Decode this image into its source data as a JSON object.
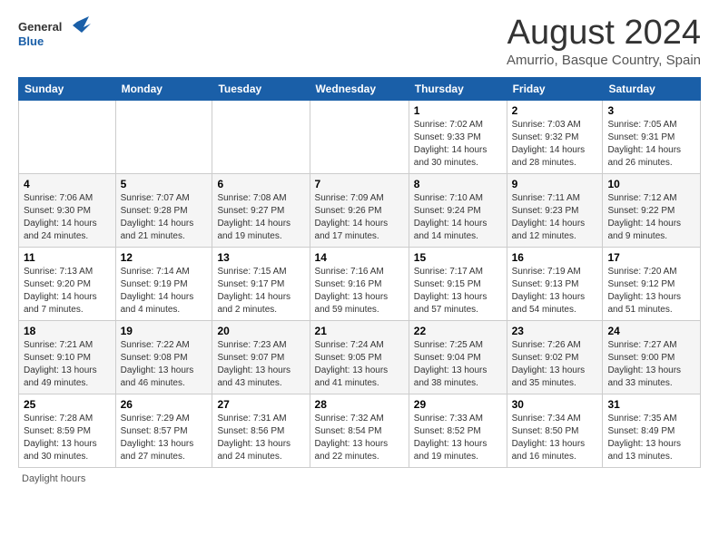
{
  "logo": {
    "general": "General",
    "blue": "Blue"
  },
  "title": "August 2024",
  "subtitle": "Amurrio, Basque Country, Spain",
  "weekdays": [
    "Sunday",
    "Monday",
    "Tuesday",
    "Wednesday",
    "Thursday",
    "Friday",
    "Saturday"
  ],
  "weeks": [
    [
      {
        "day": "",
        "info": ""
      },
      {
        "day": "",
        "info": ""
      },
      {
        "day": "",
        "info": ""
      },
      {
        "day": "",
        "info": ""
      },
      {
        "day": "1",
        "info": "Sunrise: 7:02 AM\nSunset: 9:33 PM\nDaylight: 14 hours\nand 30 minutes."
      },
      {
        "day": "2",
        "info": "Sunrise: 7:03 AM\nSunset: 9:32 PM\nDaylight: 14 hours\nand 28 minutes."
      },
      {
        "day": "3",
        "info": "Sunrise: 7:05 AM\nSunset: 9:31 PM\nDaylight: 14 hours\nand 26 minutes."
      }
    ],
    [
      {
        "day": "4",
        "info": "Sunrise: 7:06 AM\nSunset: 9:30 PM\nDaylight: 14 hours\nand 24 minutes."
      },
      {
        "day": "5",
        "info": "Sunrise: 7:07 AM\nSunset: 9:28 PM\nDaylight: 14 hours\nand 21 minutes."
      },
      {
        "day": "6",
        "info": "Sunrise: 7:08 AM\nSunset: 9:27 PM\nDaylight: 14 hours\nand 19 minutes."
      },
      {
        "day": "7",
        "info": "Sunrise: 7:09 AM\nSunset: 9:26 PM\nDaylight: 14 hours\nand 17 minutes."
      },
      {
        "day": "8",
        "info": "Sunrise: 7:10 AM\nSunset: 9:24 PM\nDaylight: 14 hours\nand 14 minutes."
      },
      {
        "day": "9",
        "info": "Sunrise: 7:11 AM\nSunset: 9:23 PM\nDaylight: 14 hours\nand 12 minutes."
      },
      {
        "day": "10",
        "info": "Sunrise: 7:12 AM\nSunset: 9:22 PM\nDaylight: 14 hours\nand 9 minutes."
      }
    ],
    [
      {
        "day": "11",
        "info": "Sunrise: 7:13 AM\nSunset: 9:20 PM\nDaylight: 14 hours\nand 7 minutes."
      },
      {
        "day": "12",
        "info": "Sunrise: 7:14 AM\nSunset: 9:19 PM\nDaylight: 14 hours\nand 4 minutes."
      },
      {
        "day": "13",
        "info": "Sunrise: 7:15 AM\nSunset: 9:17 PM\nDaylight: 14 hours\nand 2 minutes."
      },
      {
        "day": "14",
        "info": "Sunrise: 7:16 AM\nSunset: 9:16 PM\nDaylight: 13 hours\nand 59 minutes."
      },
      {
        "day": "15",
        "info": "Sunrise: 7:17 AM\nSunset: 9:15 PM\nDaylight: 13 hours\nand 57 minutes."
      },
      {
        "day": "16",
        "info": "Sunrise: 7:19 AM\nSunset: 9:13 PM\nDaylight: 13 hours\nand 54 minutes."
      },
      {
        "day": "17",
        "info": "Sunrise: 7:20 AM\nSunset: 9:12 PM\nDaylight: 13 hours\nand 51 minutes."
      }
    ],
    [
      {
        "day": "18",
        "info": "Sunrise: 7:21 AM\nSunset: 9:10 PM\nDaylight: 13 hours\nand 49 minutes."
      },
      {
        "day": "19",
        "info": "Sunrise: 7:22 AM\nSunset: 9:08 PM\nDaylight: 13 hours\nand 46 minutes."
      },
      {
        "day": "20",
        "info": "Sunrise: 7:23 AM\nSunset: 9:07 PM\nDaylight: 13 hours\nand 43 minutes."
      },
      {
        "day": "21",
        "info": "Sunrise: 7:24 AM\nSunset: 9:05 PM\nDaylight: 13 hours\nand 41 minutes."
      },
      {
        "day": "22",
        "info": "Sunrise: 7:25 AM\nSunset: 9:04 PM\nDaylight: 13 hours\nand 38 minutes."
      },
      {
        "day": "23",
        "info": "Sunrise: 7:26 AM\nSunset: 9:02 PM\nDaylight: 13 hours\nand 35 minutes."
      },
      {
        "day": "24",
        "info": "Sunrise: 7:27 AM\nSunset: 9:00 PM\nDaylight: 13 hours\nand 33 minutes."
      }
    ],
    [
      {
        "day": "25",
        "info": "Sunrise: 7:28 AM\nSunset: 8:59 PM\nDaylight: 13 hours\nand 30 minutes."
      },
      {
        "day": "26",
        "info": "Sunrise: 7:29 AM\nSunset: 8:57 PM\nDaylight: 13 hours\nand 27 minutes."
      },
      {
        "day": "27",
        "info": "Sunrise: 7:31 AM\nSunset: 8:56 PM\nDaylight: 13 hours\nand 24 minutes."
      },
      {
        "day": "28",
        "info": "Sunrise: 7:32 AM\nSunset: 8:54 PM\nDaylight: 13 hours\nand 22 minutes."
      },
      {
        "day": "29",
        "info": "Sunrise: 7:33 AM\nSunset: 8:52 PM\nDaylight: 13 hours\nand 19 minutes."
      },
      {
        "day": "30",
        "info": "Sunrise: 7:34 AM\nSunset: 8:50 PM\nDaylight: 13 hours\nand 16 minutes."
      },
      {
        "day": "31",
        "info": "Sunrise: 7:35 AM\nSunset: 8:49 PM\nDaylight: 13 hours\nand 13 minutes."
      }
    ]
  ],
  "footer": {
    "daylight_label": "Daylight hours"
  }
}
